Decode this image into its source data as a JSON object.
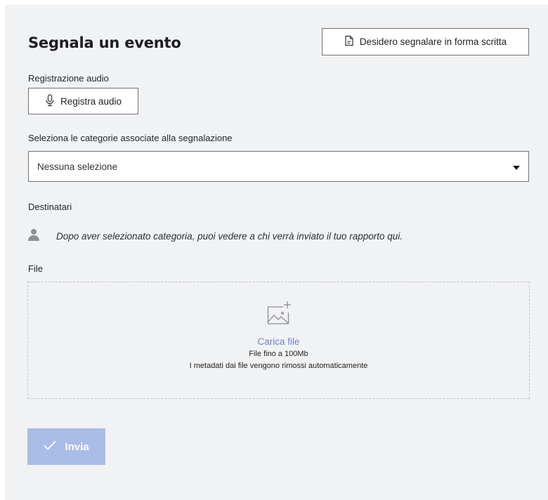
{
  "form": {
    "title": "Segnala un evento",
    "written_report_label": "Desidero segnalare in forma scritta",
    "audio_section_label": "Registrazione audio",
    "record_audio_label": "Registra audio",
    "categories_label": "Seleziona le categorie associate alla segnalazione",
    "categories_value": "Nessuna selezione",
    "recipients_label": "Destinatari",
    "recipients_hint": "Dopo aver selezionato categoria, puoi vedere a chi verrà inviato il tuo rapporto qui.",
    "file_label": "File",
    "upload_link": "Carica file",
    "upload_limit": "File fino a 100Mb",
    "upload_metadata_note": "I metadati dai file vengono rimossi automaticamente",
    "submit_label": "Invia"
  },
  "icons": {
    "written": "document-icon",
    "audio": "microphone-icon",
    "dropdown": "caret-down-icon",
    "recipient": "user-icon",
    "upload": "image-add-icon",
    "submit": "check-icon"
  },
  "colors": {
    "background": "#f1f2f4",
    "link": "#6a84c9",
    "submit_disabled": "#aabde9",
    "border": "#6f7378"
  }
}
